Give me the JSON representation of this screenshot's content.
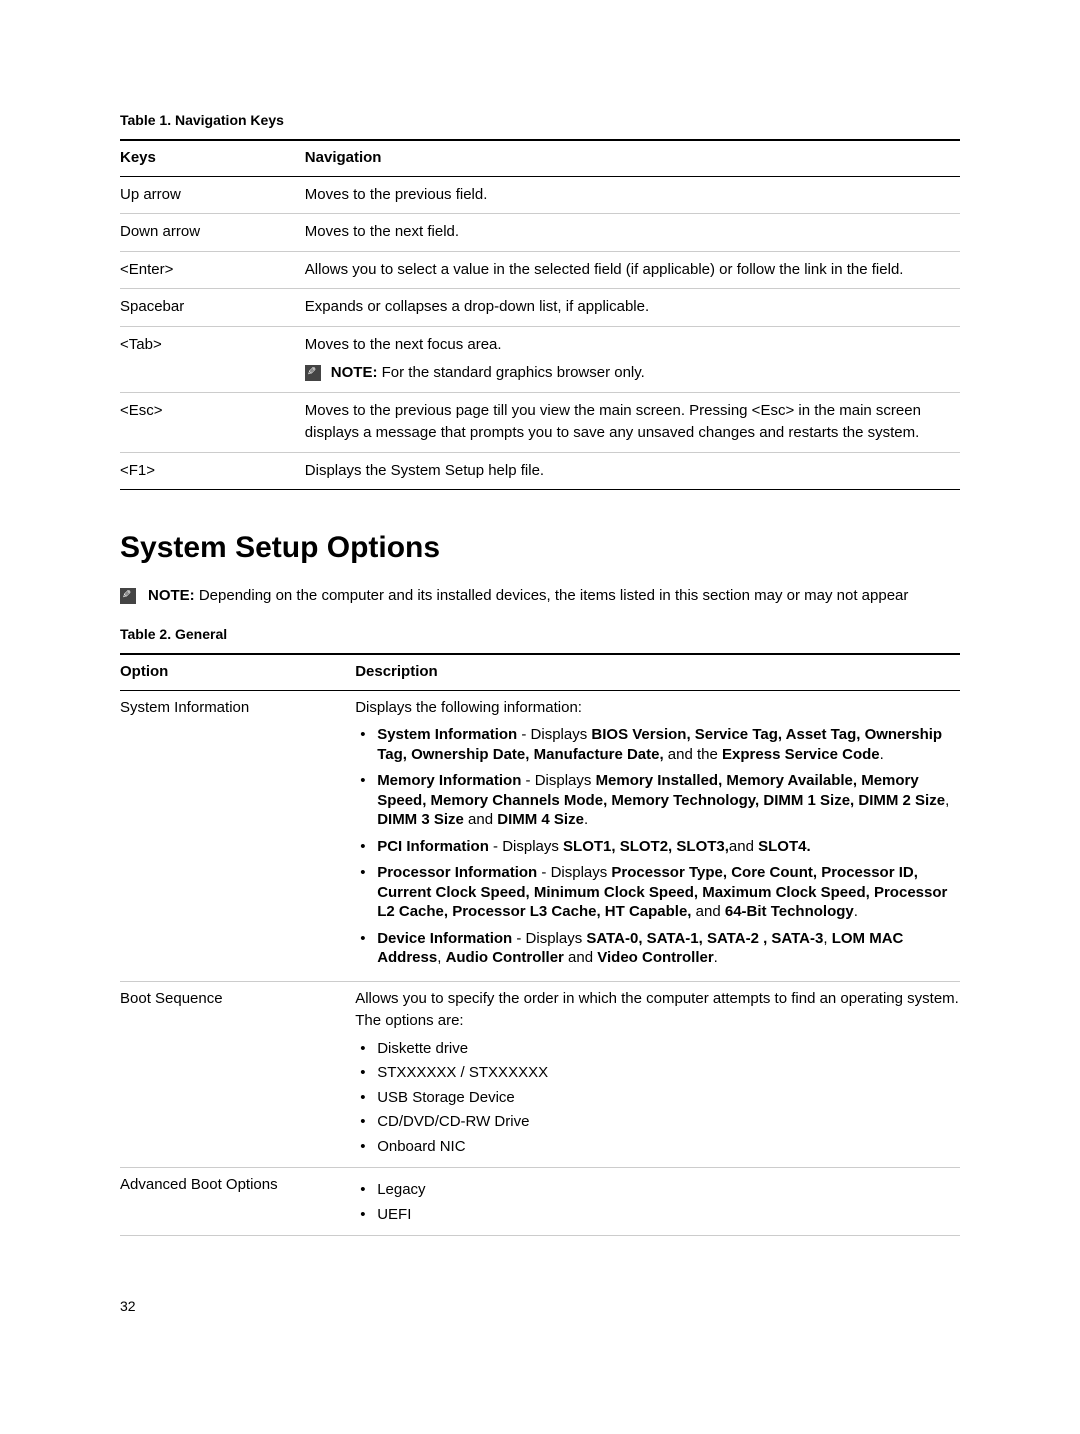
{
  "table1": {
    "caption": "Table 1. Navigation Keys",
    "headers": {
      "keys": "Keys",
      "nav": "Navigation"
    },
    "rows": [
      {
        "key": "Up arrow",
        "nav": "Moves to the previous field.",
        "note": null
      },
      {
        "key": "Down arrow",
        "nav": "Moves to the next field.",
        "note": null
      },
      {
        "key": "<Enter>",
        "nav": "Allows you to select a value in the selected field (if applicable) or follow the link in the field.",
        "note": null
      },
      {
        "key": "Spacebar",
        "nav": "Expands or collapses a drop-down list, if applicable.",
        "note": null
      },
      {
        "key": "<Tab>",
        "nav": "Moves to the next focus area.",
        "note": "NOTE: For the standard graphics browser only."
      },
      {
        "key": "<Esc>",
        "nav": "Moves to the previous page till you view the main screen. Pressing <Esc> in the main screen displays a message that prompts you to save any unsaved changes and restarts the system.",
        "note": null
      },
      {
        "key": "<F1>",
        "nav": "Displays the System Setup help file.",
        "note": null
      }
    ]
  },
  "heading": "System Setup Options",
  "intro_note": "NOTE: Depending on the computer and its installed devices, the items listed in this section may or may not appear",
  "table2": {
    "caption": "Table 2. General",
    "headers": {
      "option": "Option",
      "desc": "Description"
    }
  },
  "sysinfo": {
    "option": "System Information",
    "pre": "Displays the following information:",
    "bullets": [
      "<b>System Information</b> - Displays <b>BIOS Version, Service Tag, Asset Tag, Ownership Tag, Ownership Date, Manufacture Date,</b> and the <b>Express Service Code</b>.",
      "<b>Memory Information</b> - Displays <b>Memory Installed, Memory Available, Memory Speed, Memory Channels Mode, Memory Technology, DIMM 1 Size, DIMM 2 Size</b>, <b>DIMM 3 Size</b> and <b>DIMM 4 Size</b>.",
      "<b>PCI Information</b> - Displays <b>SLOT1, SLOT2, SLOT3,</b>and <b>SLOT4.</b>",
      "<b>Processor Information</b> - Displays <b>Processor Type, Core Count, Processor ID, Current Clock Speed, Minimum Clock Speed, Maximum Clock Speed, Processor L2 Cache, Processor L3 Cache, HT Capable,</b> and <b>64-Bit Technology</b>.",
      "<b>Device Information</b> - Displays <b>SATA-0, SATA-1, SATA-2 , SATA-3</b>, <b>LOM MAC Address</b>, <b>Audio Controller</b> and <b>Video Controller</b>."
    ]
  },
  "bootseq": {
    "option": "Boot Sequence",
    "pre": "Allows you to specify the order in which the computer attempts to find an operating system. The options are:",
    "bullets": [
      "Diskette drive",
      "STXXXXXX / STXXXXXX",
      "USB Storage Device",
      "CD/DVD/CD-RW Drive",
      "Onboard NIC"
    ]
  },
  "advboot": {
    "option": "Advanced Boot Options",
    "bullets": [
      "Legacy",
      "UEFI"
    ]
  },
  "page_number": "32"
}
